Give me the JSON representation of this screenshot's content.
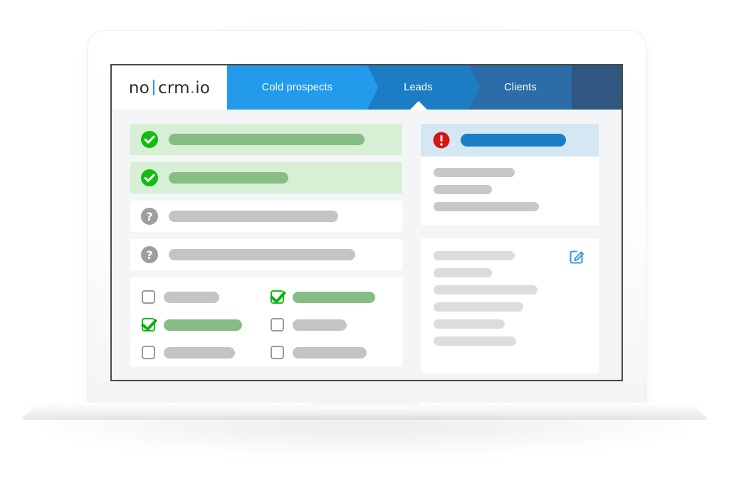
{
  "device": {
    "type": "laptop-mockup",
    "chassis_color": "#f4f4f4",
    "bezel_color": "#4a4a4a"
  },
  "app": {
    "brand": {
      "text_left": "no",
      "text_right": "crm",
      "dot": ".",
      "text_tail": "io",
      "bar_color": "#2196f3",
      "dot_color": "#3fbf3f"
    },
    "pipeline": {
      "active_stage": "Leads",
      "stages": [
        {
          "label": "Cold prospects",
          "color": "#239bec",
          "active": false
        },
        {
          "label": "Leads",
          "color": "#1c7dc4",
          "active": true
        },
        {
          "label": "Clients",
          "color": "#2c6ca8",
          "active": false
        },
        {
          "label": "",
          "color": "#31567f",
          "active": false
        }
      ]
    },
    "left_column": {
      "lead_rows": [
        {
          "status": "won",
          "status_icon": "check-circle-icon",
          "row_bg": "#d6efd5",
          "pill_color": "#85bd84",
          "pill_width": 275
        },
        {
          "status": "won",
          "status_icon": "check-circle-icon",
          "row_bg": "#d6efd5",
          "pill_color": "#85bd84",
          "pill_width": 168
        },
        {
          "status": "open",
          "status_icon": "question-circle-icon",
          "row_bg": "#ffffff",
          "pill_color": "#c4c4c4",
          "pill_width": 238
        },
        {
          "status": "open",
          "status_icon": "question-circle-icon",
          "row_bg": "#ffffff",
          "pill_color": "#c4c4c4",
          "pill_width": 262
        }
      ],
      "checkbox_card": {
        "items": [
          {
            "checked": false,
            "pill_color": "#c4c4c4",
            "pill_width": 78
          },
          {
            "checked": true,
            "pill_color": "#85bd84",
            "pill_width": 116
          },
          {
            "checked": true,
            "pill_color": "#85bd84",
            "pill_width": 110
          },
          {
            "checked": false,
            "pill_color": "#c4c4c4",
            "pill_width": 76
          },
          {
            "checked": false,
            "pill_color": "#c4c4c4",
            "pill_width": 100
          },
          {
            "checked": false,
            "pill_color": "#c4c4c4",
            "pill_width": 104
          }
        ]
      }
    },
    "right_column": {
      "alert_card": {
        "header_bg": "#d4e8f4",
        "status_icon": "alert-circle-icon",
        "header_pill_color": "#1a7fc6",
        "header_pill_width": 148,
        "body_lines": [
          {
            "width": 114,
            "color": "#c8c8c8"
          },
          {
            "width": 82,
            "color": "#c8c8c8"
          },
          {
            "width": 148,
            "color": "#c8c8c8"
          }
        ]
      },
      "detail_card": {
        "action_icon": "edit-pencil-icon",
        "action_icon_color": "#3c9ced",
        "body_lines": [
          {
            "width": 114,
            "color": "#dcdcdc"
          },
          {
            "width": 82,
            "color": "#dcdcdc"
          },
          {
            "width": 146,
            "color": "#dcdcdc"
          },
          {
            "width": 126,
            "color": "#dcdcdc"
          },
          {
            "width": 100,
            "color": "#dcdcdc"
          },
          {
            "width": 116,
            "color": "#dcdcdc"
          }
        ]
      }
    }
  }
}
